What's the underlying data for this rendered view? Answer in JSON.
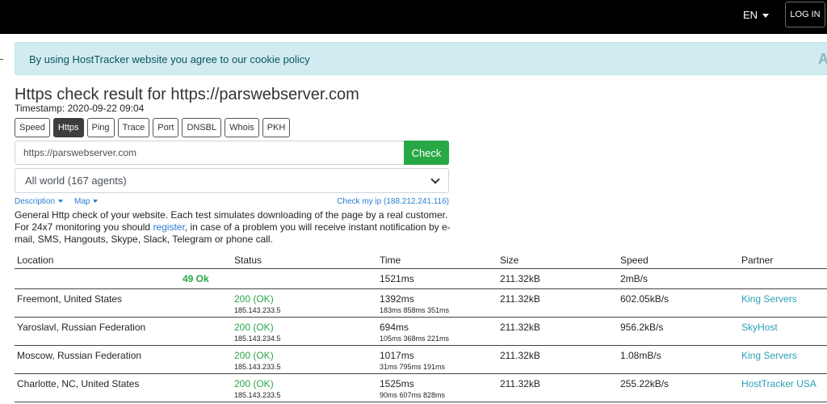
{
  "topbar": {
    "lang": "EN",
    "login": "LOG IN"
  },
  "cookie": {
    "text_prefix": "By using HostTracker website you agree to our ",
    "link": "cookie policy",
    "edge": "A"
  },
  "page": {
    "title": "Https check result for https://parswebserver.com",
    "timestamp": "Timestamp: 2020-09-22 09:04"
  },
  "tabs": [
    "Speed",
    "Https",
    "Ping",
    "Trace",
    "Port",
    "DNSBL",
    "Whois",
    "PKH"
  ],
  "active_tab": "Https",
  "form": {
    "url_value": "https://parswebserver.com",
    "check_label": "Check",
    "agents_selected": "All world (167 agents)"
  },
  "links": {
    "description": "Description",
    "map": "Map",
    "myip": "Check my ip (188.212.241.116)"
  },
  "desc": {
    "text1": "General Http check of your website. Each test simulates downloading of the page by a real customer. For 24x7 monitoring you should ",
    "register": "register",
    "text2": ", in case of a problem you will receive instant notification by e-mail, SMS, Hangouts, Skype, Slack, Telegram or phone call."
  },
  "table": {
    "headers": {
      "location": "Location",
      "status": "Status",
      "time": "Time",
      "size": "Size",
      "speed": "Speed",
      "partner": "Partner"
    },
    "summary": {
      "ok": "49 Ok",
      "time": "1521ms",
      "size": "211.32kB",
      "speed": "2mB/s"
    },
    "rows": [
      {
        "location": "Freemont, United States",
        "status": "200 (OK)",
        "ip": "185.143.233.5",
        "time": "1392ms",
        "timing": "183ms 858ms 351ms",
        "size": "211.32kB",
        "speed": "602.05kB/s",
        "partner": "King Servers"
      },
      {
        "location": "Yaroslavl, Russian Federation",
        "status": "200 (OK)",
        "ip": "185.143.234.5",
        "time": "694ms",
        "timing": "105ms 368ms 221ms",
        "size": "211.32kB",
        "speed": "956.2kB/s",
        "partner": "SkyHost"
      },
      {
        "location": "Moscow, Russian Federation",
        "status": "200 (OK)",
        "ip": "185.143.233.5",
        "time": "1017ms",
        "timing": "31ms 795ms 191ms",
        "size": "211.32kB",
        "speed": "1.08mB/s",
        "partner": "King Servers"
      },
      {
        "location": "Charlotte, NC, United States",
        "status": "200 (OK)",
        "ip": "185.143.233.5",
        "time": "1525ms",
        "timing": "90ms 607ms 828ms",
        "size": "211.32kB",
        "speed": "255.22kB/s",
        "partner": "HostTracker USA"
      }
    ]
  }
}
